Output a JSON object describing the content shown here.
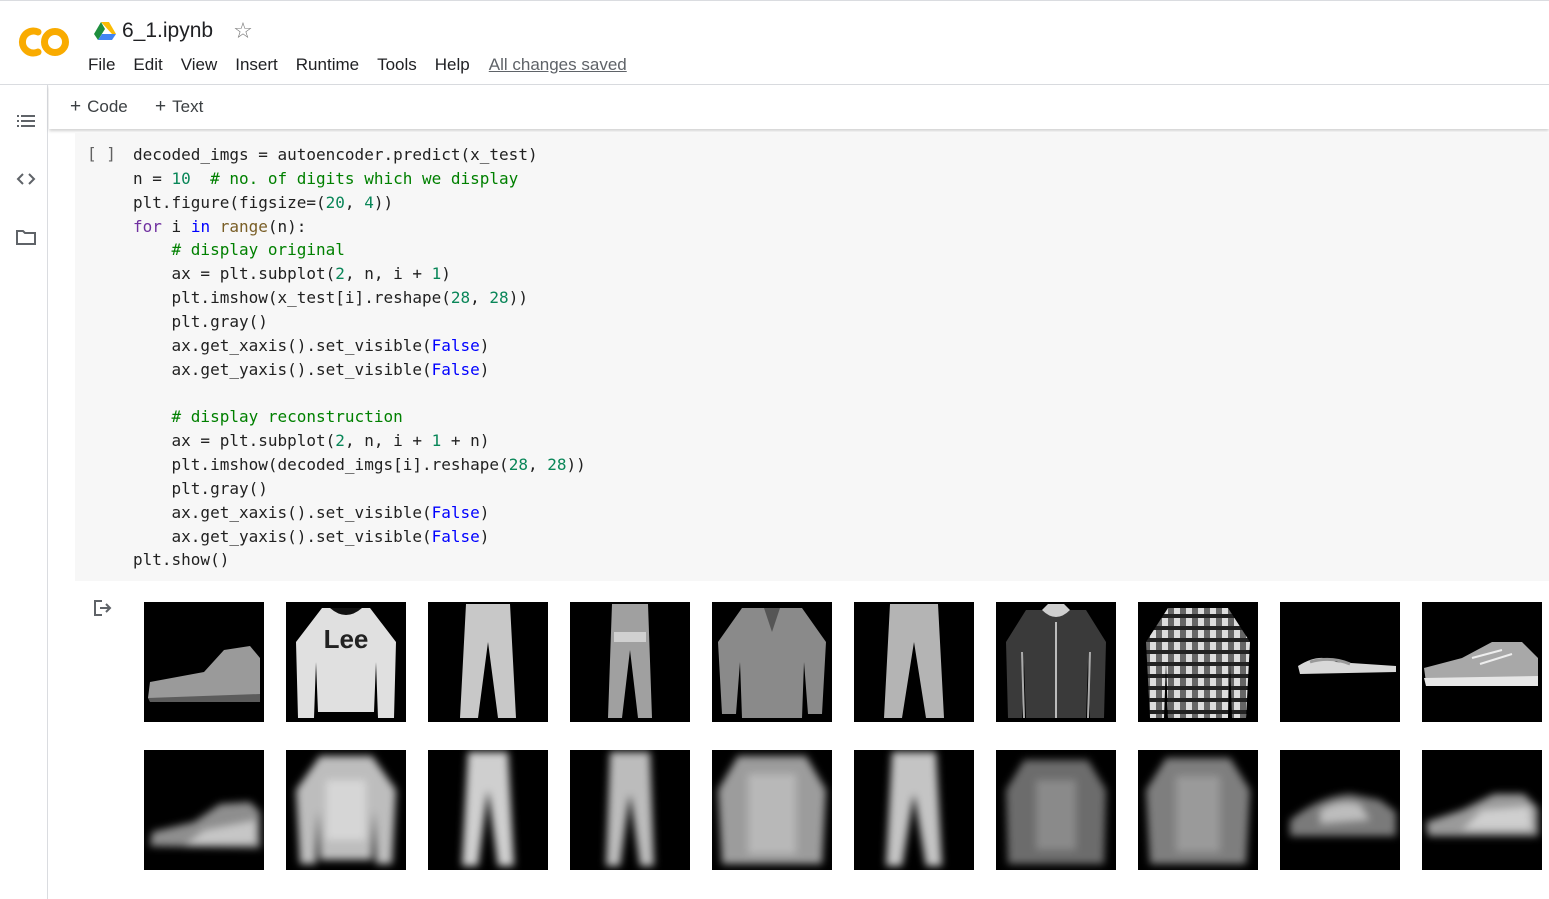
{
  "app": {
    "logo_text": "CO",
    "brand_color": "#f9ab00"
  },
  "notebook": {
    "title": "6_1.ipynb",
    "status": "All changes saved"
  },
  "menu": [
    "File",
    "Edit",
    "View",
    "Insert",
    "Runtime",
    "Tools",
    "Help"
  ],
  "toolbar": {
    "code_label": "Code",
    "text_label": "Text"
  },
  "sidebar": {
    "icons": [
      "toc-icon",
      "code-snippets-icon",
      "files-folder-icon"
    ]
  },
  "cell": {
    "run_indicator": "[ ]",
    "code_lines": [
      "decoded_imgs = autoencoder.predict(x_test)",
      "n = 10  # no. of digits which we display",
      "plt.figure(figsize=(20, 4))",
      "for i in range(n):",
      "    # display original",
      "    ax = plt.subplot(2, n, i + 1)",
      "    plt.imshow(x_test[i].reshape(28, 28))",
      "    plt.gray()",
      "    ax.get_xaxis().set_visible(False)",
      "    ax.get_yaxis().set_visible(False)",
      "",
      "    # display reconstruction",
      "    ax = plt.subplot(2, n, i + 1 + n)",
      "    plt.imshow(decoded_imgs[i].reshape(28, 28))",
      "    plt.gray()",
      "    ax.get_xaxis().set_visible(False)",
      "    ax.get_yaxis().set_visible(False)",
      "plt.show()"
    ]
  },
  "output": {
    "items": [
      "ankle-boot",
      "pullover",
      "trouser",
      "trouser",
      "shirt",
      "trouser",
      "coat",
      "shirt",
      "sandal",
      "sneaker"
    ],
    "original_logo_text": "Lee"
  }
}
